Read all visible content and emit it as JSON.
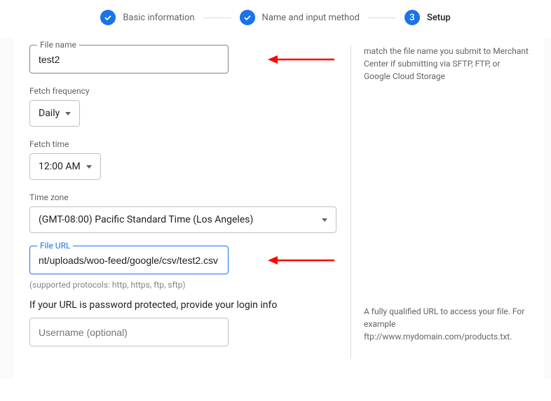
{
  "stepper": {
    "step1": {
      "label": "Basic information"
    },
    "step2": {
      "label": "Name and input method"
    },
    "step3": {
      "number": "3",
      "label": "Setup"
    }
  },
  "fileName": {
    "label": "File name",
    "value": "test2",
    "help": "match the file name you submit to Merchant Center if submitting via SFTP, FTP, or Google Cloud Storage"
  },
  "fetchFrequency": {
    "label": "Fetch frequency",
    "value": "Daily"
  },
  "fetchTime": {
    "label": "Fetch time",
    "value": "12:00 AM"
  },
  "timeZone": {
    "label": "Time zone",
    "value": "(GMT-08:00) Pacific Standard Time (Los Angeles)"
  },
  "fileUrl": {
    "label": "File URL",
    "value": "nt/uploads/woo-feed/google/csv/test2.csv",
    "hint": "(supported protocols: http, https, ftp, sftp)",
    "help": "A fully qualified URL to access your file. For example ftp://www.mydomain.com/products.txt."
  },
  "loginInfo": {
    "text": "If your URL is password protected, provide your login info",
    "usernamePlaceholder": "Username (optional)"
  }
}
